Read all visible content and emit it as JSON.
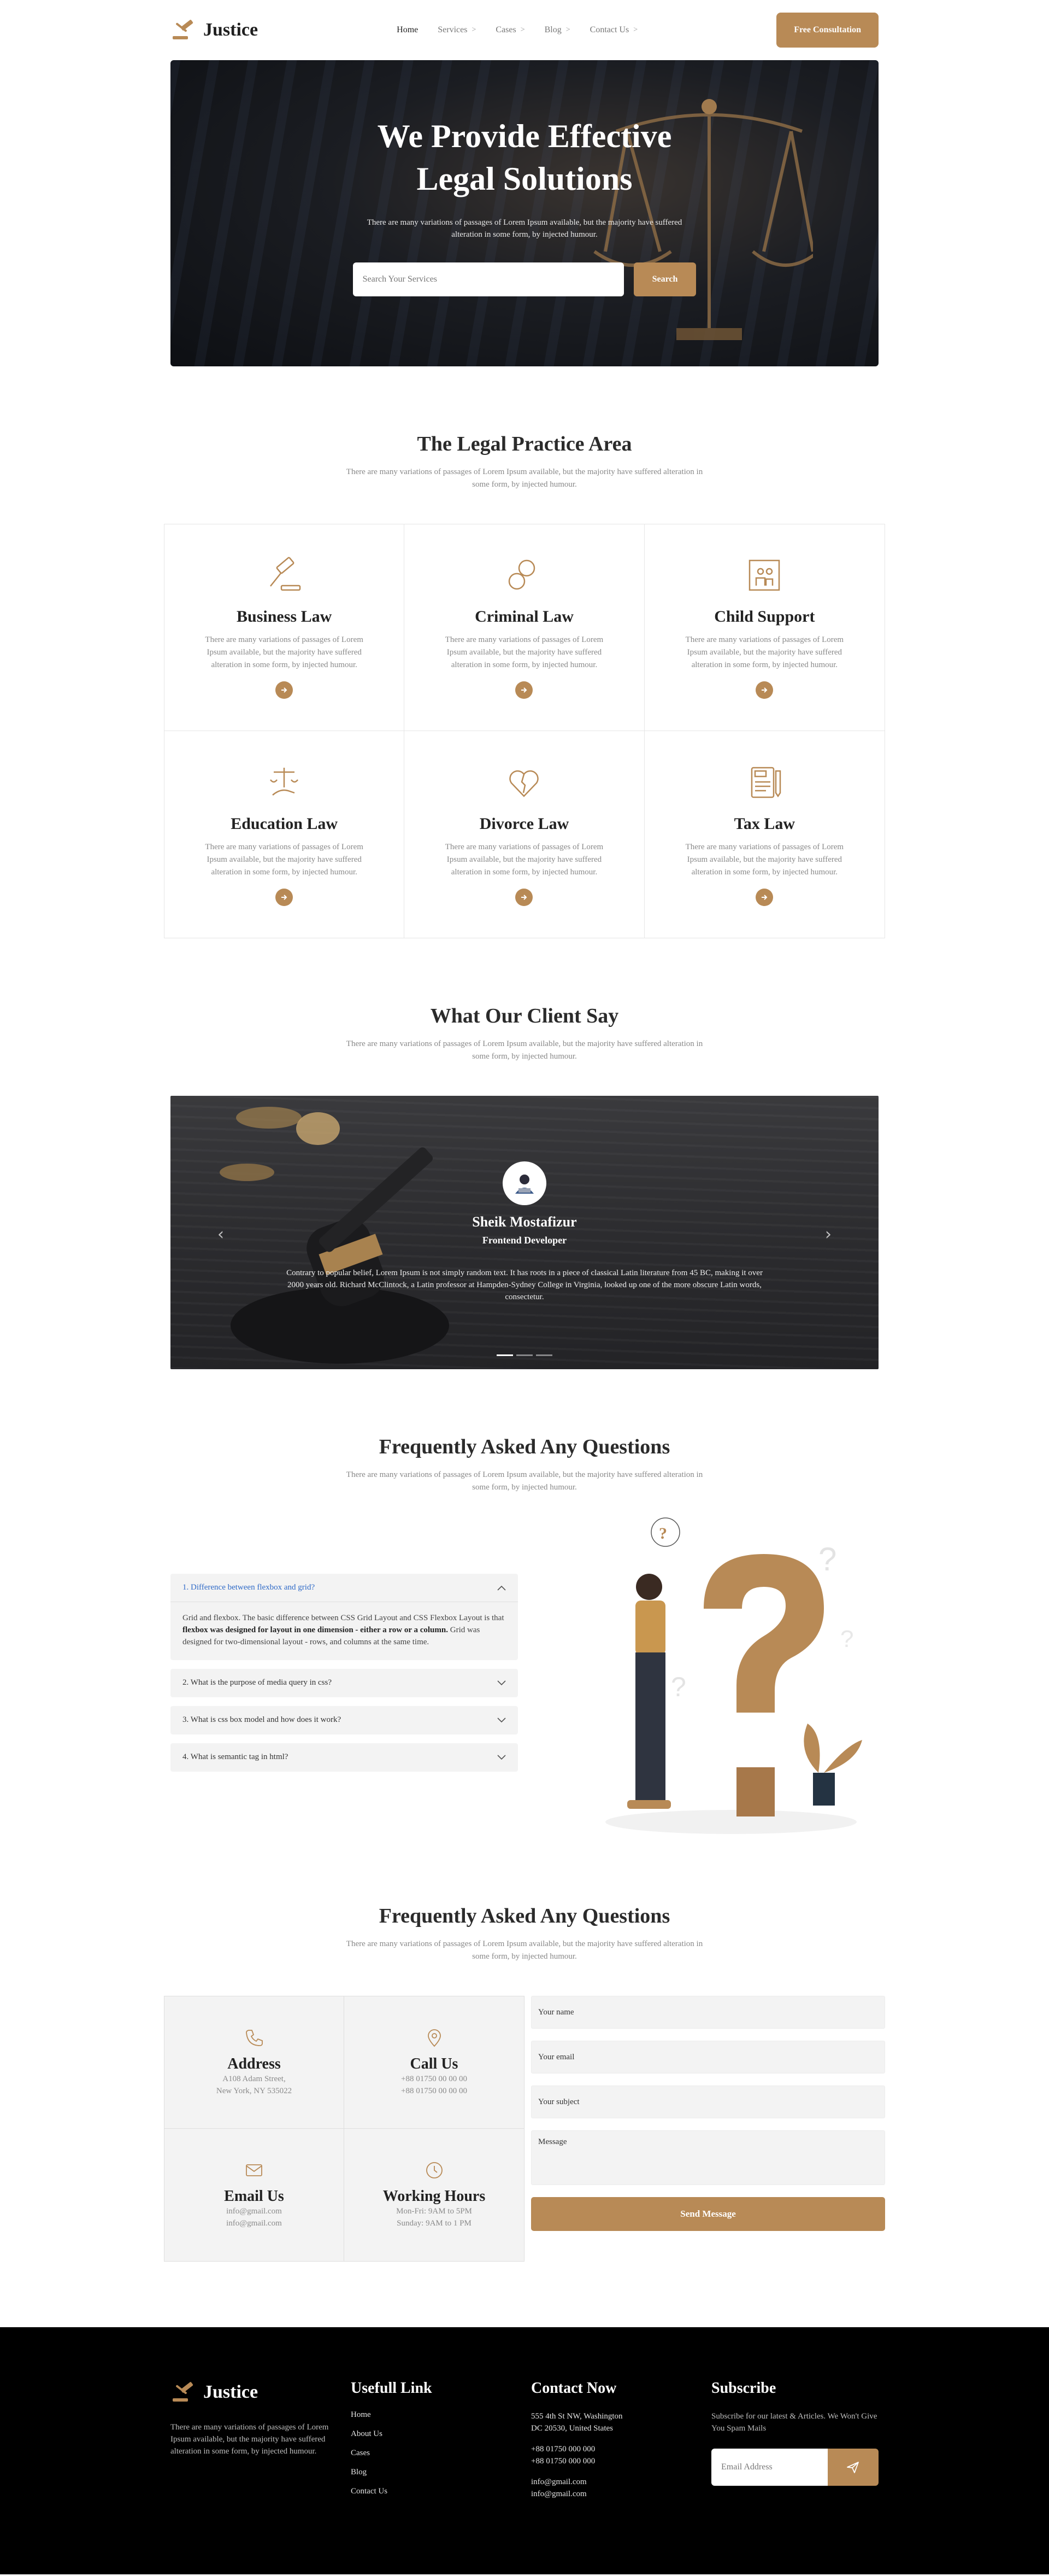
{
  "brand": {
    "name": "Justice",
    "accent": "#b88a56"
  },
  "nav": {
    "items": [
      {
        "label": "Home",
        "active": true,
        "chevron": false
      },
      {
        "label": "Services",
        "active": false,
        "chevron": true
      },
      {
        "label": "Cases",
        "active": false,
        "chevron": true
      },
      {
        "label": "Blog",
        "active": false,
        "chevron": true
      },
      {
        "label": "Contact Us",
        "active": false,
        "chevron": true
      }
    ],
    "chevron_glyph": ">",
    "cta": "Free Consultation"
  },
  "hero": {
    "title_line1": "We Provide Effective",
    "title_line2": "Legal Solutions",
    "description": "There are many variations of passages of Lorem Ipsum available, but the majority have suffered alteration in some form, by injected humour.",
    "search_placeholder": "Search Your Services",
    "search_button": "Search"
  },
  "practice": {
    "title": "The Legal Practice Area",
    "subtitle": "There are many variations of passages of Lorem Ipsum available, but the majority have suffered alteration in some form, by injected humour.",
    "cards": [
      {
        "title": "Business Law",
        "icon": "gavel-icon",
        "text": "There are many variations of passages of Lorem Ipsum available, but the majority have suffered alteration in some form, by injected humour."
      },
      {
        "title": "Criminal Law",
        "icon": "handcuffs-icon",
        "text": "There are many variations of passages of Lorem Ipsum available, but the majority have suffered alteration in some form, by injected humour."
      },
      {
        "title": "Child Support",
        "icon": "family-icon",
        "text": "There are many variations of passages of Lorem Ipsum available, but the majority have suffered alteration in some form, by injected humour."
      },
      {
        "title": "Education Law",
        "icon": "scales-hand-icon",
        "text": "There are many variations of passages of Lorem Ipsum available, but the majority have suffered alteration in some form, by injected humour."
      },
      {
        "title": "Divorce Law",
        "icon": "broken-heart-icon",
        "text": "There are many variations of passages of Lorem Ipsum available, but the majority have suffered alteration in some form, by injected humour."
      },
      {
        "title": "Tax Law",
        "icon": "tax-document-icon",
        "text": "There are many variations of passages of Lorem Ipsum available, but the majority have suffered alteration in some form, by injected humour."
      }
    ]
  },
  "testimonial": {
    "title": "What Our Client Say",
    "subtitle": "There are many variations of passages of Lorem Ipsum available, but the majority have suffered alteration in some form, by injected humour.",
    "name": "Sheik Mostafizur",
    "role": "Frontend Developer",
    "quote": "Contrary to popular belief, Lorem Ipsum is not simply random text. It has roots in a piece of classical Latin literature from 45 BC, making it over 2000 years old. Richard McClintock, a Latin professor at Hampden-Sydney College in Virginia, looked up one of the more obscure Latin words, consectetur.",
    "prev": "‹",
    "next": "›"
  },
  "faq": {
    "title": "Frequently Asked Any Questions",
    "subtitle": "There are many variations of passages of Lorem Ipsum available, but the majority have suffered alteration in some form, by injected humour.",
    "items": [
      {
        "q": "1. Difference between flexbox and grid?",
        "open": true
      },
      {
        "q": "2. What is the purpose of media query in css?",
        "open": false
      },
      {
        "q": "3. What is css box model and how does it work?",
        "open": false
      },
      {
        "q": "4. What is semantic tag in html?",
        "open": false
      }
    ],
    "answer_part1": "Grid and flexbox. The basic difference between CSS Grid Layout and CSS Flexbox Layout is that ",
    "answer_bold": "flexbox was designed for layout in one dimension - either a row or a column.",
    "answer_part2": " Grid was designed for two-dimensional layout - rows, and columns at the same time."
  },
  "contact": {
    "title": "Frequently Asked Any Questions",
    "subtitle": "There are many variations of passages of Lorem Ipsum available, but the majority have suffered alteration in some form, by injected humour.",
    "cards": [
      {
        "title": "Address",
        "icon": "phone-icon",
        "line1": "A108 Adam Street,",
        "line2": "New York, NY 535022"
      },
      {
        "title": "Call Us",
        "icon": "location-pin-icon",
        "line1": "+88 01750 00 00 00",
        "line2": "+88 01750 00 00 00"
      },
      {
        "title": "Email Us",
        "icon": "envelope-icon",
        "line1": "info@gmail.com",
        "line2": "info@gmail.com"
      },
      {
        "title": "Working Hours",
        "icon": "clock-icon",
        "line1": "Mon-Fri: 9AM to 5PM",
        "line2": "Sunday: 9AM to 1 PM"
      }
    ],
    "form": {
      "name": "Your name",
      "email": "Your email",
      "subject": "Your subject",
      "message": "Message",
      "submit": "Send Message"
    }
  },
  "footer": {
    "about": "There are many variations of passages of Lorem Ipsum available, but the majority have suffered alteration in some form, by injected humour.",
    "links_title": "Usefull Link",
    "links": [
      "Home",
      "About Us",
      "Cases",
      "Blog",
      "Contact Us"
    ],
    "contact_title": "Contact Now",
    "address_line1": "555 4th St NW, Washington",
    "address_line2": "DC 20530, United States",
    "phone1": "+88 01750 000 000",
    "phone2": "+88 01750 000 000",
    "email1": "info@gmail.com",
    "email2": "info@gmail.com",
    "subscribe_title": "Subscribe",
    "subscribe_text": "Subscribe for our latest & Articles. We Won't Give You Spam Mails",
    "email_placeholder": "Email Address"
  }
}
